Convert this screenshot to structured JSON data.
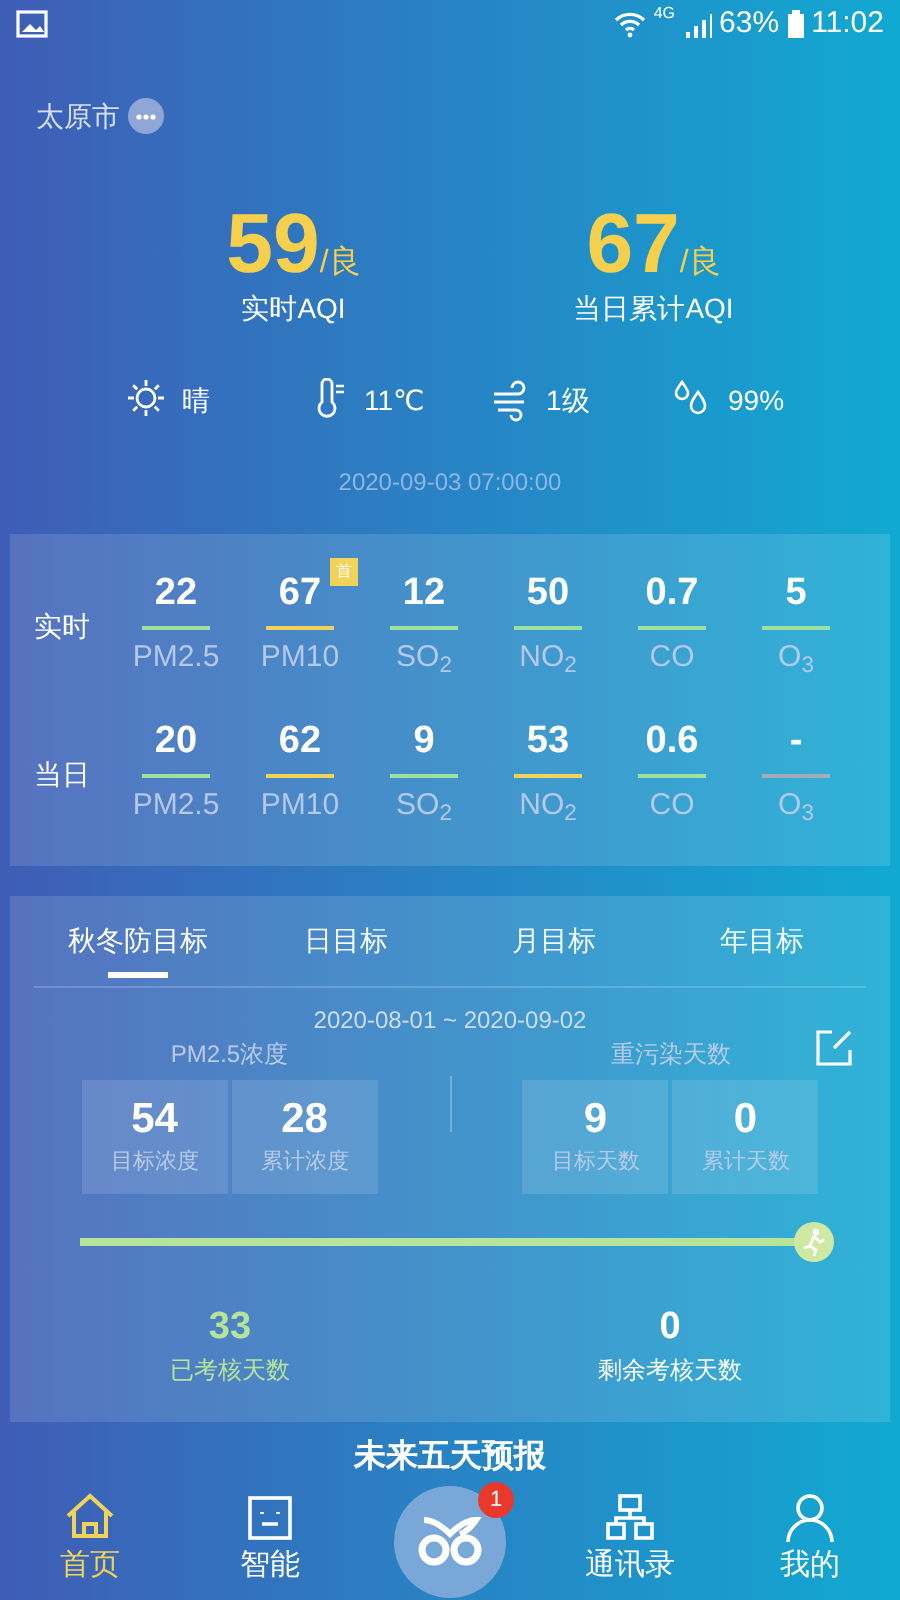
{
  "status_bar": {
    "network": "4G",
    "battery": "63%",
    "time": "11:02"
  },
  "city": "太原市",
  "aqi": [
    {
      "value": "59",
      "grade": "/良",
      "label": "实时AQI"
    },
    {
      "value": "67",
      "grade": "/良",
      "label": "当日累计AQI"
    }
  ],
  "weather": [
    {
      "kind": "sun",
      "text": "晴"
    },
    {
      "kind": "thermometer",
      "text": "11℃"
    },
    {
      "kind": "wind",
      "text": "1级"
    },
    {
      "kind": "humidity",
      "text": "99%"
    }
  ],
  "timestamp": "2020-09-03 07:00:00",
  "pollutants": [
    {
      "label": "实时",
      "items": [
        {
          "value": "22",
          "name": "PM2.5",
          "color": "#9ee0a0"
        },
        {
          "value": "67",
          "name": "PM10",
          "color": "#f2d35a",
          "badge": "首"
        },
        {
          "value": "12",
          "name": "SO$_{2}$",
          "color": "#9ee0a0"
        },
        {
          "value": "50",
          "name": "NO$_{2}$",
          "color": "#9ee0a0"
        },
        {
          "value": "0.7",
          "name": "CO",
          "color": "#9ee0a0"
        },
        {
          "value": "5",
          "name": "O$_{3}$",
          "color": "#9ee0a0"
        }
      ]
    },
    {
      "label": "当日",
      "items": [
        {
          "value": "20",
          "name": "PM2.5",
          "color": "#9ee0a0"
        },
        {
          "value": "62",
          "name": "PM10",
          "color": "#f2d35a"
        },
        {
          "value": "9",
          "name": "SO$_{2}$",
          "color": "#9ee0a0"
        },
        {
          "value": "53",
          "name": "NO$_{2}$",
          "color": "#f2d35a"
        },
        {
          "value": "0.6",
          "name": "CO",
          "color": "#9ee0a0"
        },
        {
          "value": "-",
          "name": "O$_{3}$",
          "color": "#a3abb8"
        }
      ]
    }
  ],
  "targets": {
    "tabs": [
      {
        "label": "秋冬防目标",
        "selected": true
      },
      {
        "label": "日目标",
        "selected": false
      },
      {
        "label": "月目标",
        "selected": false
      },
      {
        "label": "年目标",
        "selected": false
      }
    ],
    "date_range": "2020-08-01 ~ 2020-09-02",
    "groups": [
      {
        "title": "PM2.5浓度",
        "cells": [
          {
            "value": "54",
            "label": "目标浓度"
          },
          {
            "value": "28",
            "label": "累计浓度"
          }
        ]
      },
      {
        "title": "重污染天数",
        "cells": [
          {
            "value": "9",
            "label": "目标天数"
          },
          {
            "value": "0",
            "label": "累计天数"
          }
        ]
      }
    ],
    "progress": {
      "level": 1.0
    },
    "stats": [
      {
        "kind": "done",
        "value": "33",
        "label": "已考核天数"
      },
      {
        "kind": "remaining",
        "value": "0",
        "label": "剩余考核天数"
      }
    ]
  },
  "forecast_heading": "未来五天预报",
  "nav": {
    "items": [
      {
        "kind": "home",
        "label": "首页",
        "selected": true
      },
      {
        "kind": "robot",
        "label": "智能",
        "selected": false
      },
      {
        "kind": "center",
        "badge": "1"
      },
      {
        "kind": "network",
        "label": "通讯录",
        "selected": false
      },
      {
        "kind": "person",
        "label": "我的",
        "selected": false
      }
    ]
  }
}
